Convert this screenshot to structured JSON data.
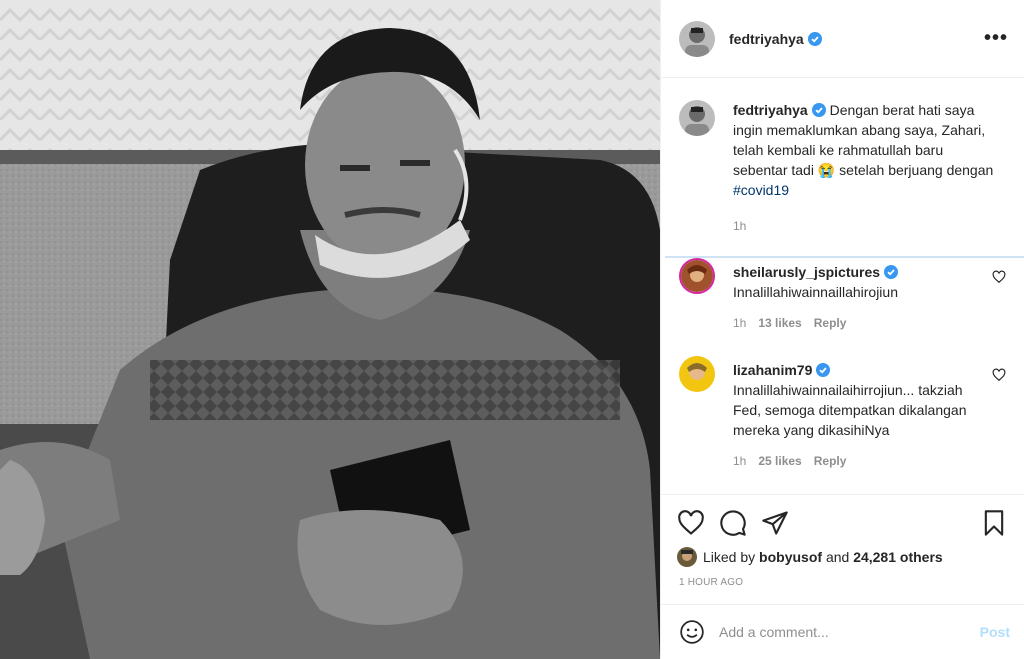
{
  "post": {
    "username": "fedtriyahya",
    "caption_main": "Dengan berat hati saya ingin memaklumkan abang saya, Zahari, telah kembali ke rahmatullah baru sebentar tadi 😭 setelah berjuang dengan ",
    "hashtag": "#covid19",
    "caption_time": "1h",
    "more_label": "•••"
  },
  "comments": [
    {
      "username": "sheilarusly_jspictures",
      "text": "Innalillahiwainnaillahirojiun",
      "time": "1h",
      "likes": "13 likes",
      "reply": "Reply"
    },
    {
      "username": "lizahanim79",
      "text": "Innalillahiwainnailaihirrojiun... takziah Fed, semoga ditempatkan dikalangan mereka yang dikasihiNya",
      "time": "1h",
      "likes": "25 likes",
      "reply": "Reply"
    }
  ],
  "likes": {
    "prefix": "Liked by",
    "user": "bobyusof",
    "joiner": "and",
    "others": "24,281 others"
  },
  "timestamp": "1 HOUR AGO",
  "comment_box": {
    "placeholder": "Add a comment...",
    "post_label": "Post"
  },
  "colors": {
    "verified": "#3897f0",
    "hashtag": "#00376b",
    "post_disabled": "#b2dffc",
    "muted": "#8e8e8e"
  }
}
